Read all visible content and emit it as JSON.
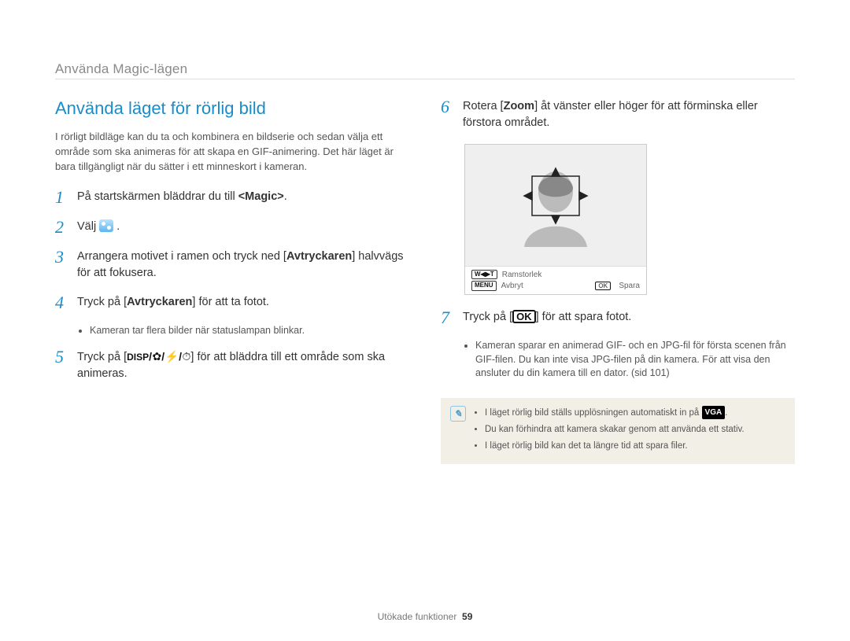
{
  "header": {
    "breadcrumb": "Använda Magic-lägen"
  },
  "heading": "Använda läget för rörlig bild",
  "intro": "I rörligt bildläge kan du ta och kombinera en bildserie och sedan välja ett område som ska animeras för att skapa en GIF-animering. Det här läget är bara tillgängligt när du sätter i ett minneskort i kameran.",
  "steps": {
    "s1": {
      "num": "1",
      "pre": "På startskärmen bläddrar du till ",
      "strong": "<Magic>",
      "post": "."
    },
    "s2": {
      "num": "2",
      "text": "Välj "
    },
    "s3": {
      "num": "3",
      "pre": "Arrangera motivet i ramen och tryck ned [",
      "strong": "Avtryckaren",
      "post": "] halvvägs för att fokusera."
    },
    "s4": {
      "num": "4",
      "pre": "Tryck på [",
      "strong": "Avtryckaren",
      "post": "] för att ta fotot.",
      "bullet": "Kameran tar flera bilder när statuslampan blinkar."
    },
    "s5": {
      "num": "5",
      "pre": "Tryck på [",
      "post": "] för att bläddra till ett område som ska animeras."
    },
    "s6": {
      "num": "6",
      "pre": "Rotera [",
      "strong": "Zoom",
      "post": "] åt vänster eller höger för att förminska eller förstora området."
    },
    "s7": {
      "num": "7",
      "pre": "Tryck på [",
      "post": "] för att spara fotot.",
      "bullet": "Kameran sparar en animerad GIF- och en JPG-fil för första scenen från GIF-filen. Du kan inte visa JPG-filen på din kamera. För att visa den ansluter du din kamera till en dator. (sid 101)"
    }
  },
  "preview": {
    "line1_badge": "W◀▶T",
    "line1_label": "Ramstorlek",
    "line2_menu": "MENU",
    "line2_cancel": "Avbryt",
    "line2_ok": "OK",
    "line2_save": "Spara"
  },
  "notes": {
    "n1_pre": "I läget rörlig bild ställs upplösningen automatiskt in på ",
    "n1_post": ".",
    "n2": "Du kan förhindra att kamera skakar genom att använda ett stativ.",
    "n3": "I läget rörlig bild kan det ta längre tid att spara filer."
  },
  "icons": {
    "disp": "DISP",
    "ok": "OK",
    "vga": "VGA"
  },
  "footer": {
    "section": "Utökade funktioner",
    "page": "59"
  }
}
